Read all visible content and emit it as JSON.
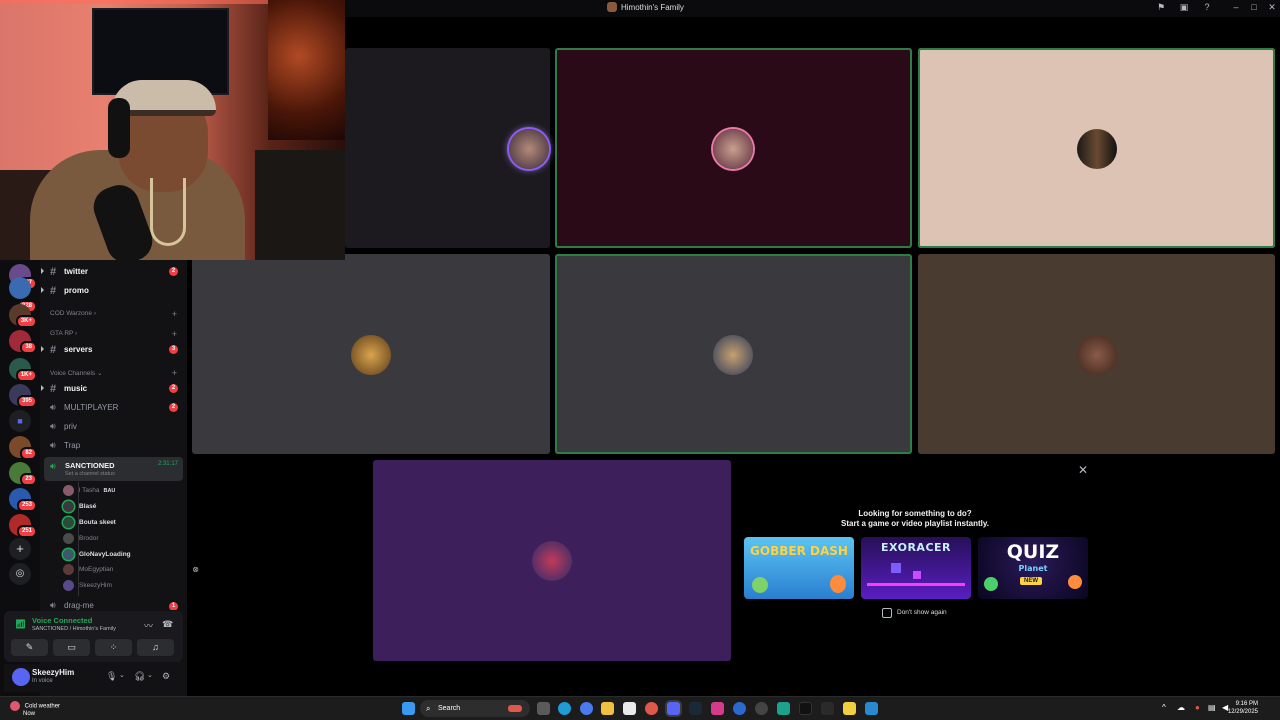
{
  "window": {
    "title": "Himothin's Family"
  },
  "rail": {
    "badges": [
      "187",
      "828",
      "3K+",
      "38",
      "1K+",
      "395",
      "82",
      "23",
      "253",
      "251"
    ]
  },
  "sidebar": {
    "channels_top": [
      {
        "name": "twitter",
        "badge": "2"
      },
      {
        "name": "promo",
        "badge": ""
      }
    ],
    "categories": {
      "cod": "COD Warzone",
      "gta": "GTA RP",
      "voice": "Voice Channels"
    },
    "servers_channel": {
      "name": "servers",
      "badge": "3"
    },
    "music_channel": {
      "name": "music",
      "badge": "2"
    },
    "voice_channels": [
      {
        "name": "MULTIPLAYER",
        "badge": "2"
      },
      {
        "name": "priv",
        "badge": ""
      },
      {
        "name": "Trap",
        "badge": ""
      }
    ],
    "active_voice": {
      "name": "SANCTIONED",
      "timer": "2:31:17",
      "status": "Set a channel status"
    },
    "voice_users": [
      {
        "name": "l Tasha",
        "tag": "BAU",
        "muted": true
      },
      {
        "name": "Blasé",
        "muted": false
      },
      {
        "name": "Bouta skeet",
        "muted": false
      },
      {
        "name": "Brodor",
        "muted": true
      },
      {
        "name": "GloNavyLoading",
        "muted": false
      },
      {
        "name": "MoEgyptian",
        "muted": true
      },
      {
        "name": "SkeezyHim",
        "muted": true
      }
    ],
    "partial_channel": {
      "name": "drag-me",
      "badge": "1"
    }
  },
  "voice_panel": {
    "title": "Voice Connected",
    "subtitle": "SANCTIONED / Himothin's Family"
  },
  "user_panel": {
    "username": "SkeezyHim",
    "status": "In voice"
  },
  "activity": {
    "heading": "Looking for something to do?",
    "subheading": "Start a game or video playlist instantly.",
    "games": [
      {
        "name": "GOBBER DASH",
        "color": "#3b9de0"
      },
      {
        "name": "EXORACER",
        "color": "#3a1c7a"
      },
      {
        "name": "QUIZ",
        "sub": "Planet",
        "tag": "NEW",
        "color": "#1c0c3a"
      }
    ],
    "checkbox_label": "Don't show again"
  },
  "taskbar": {
    "weather_title": "Cold weather",
    "weather_sub": "Now",
    "search": "Search",
    "time": "9:16 PM",
    "date": "12/29/2025"
  },
  "colors": {
    "speaking_border": "#2d7d46",
    "badge": "#f23f43",
    "voice_green": "#23a55a",
    "blurple": "#5865f2"
  }
}
